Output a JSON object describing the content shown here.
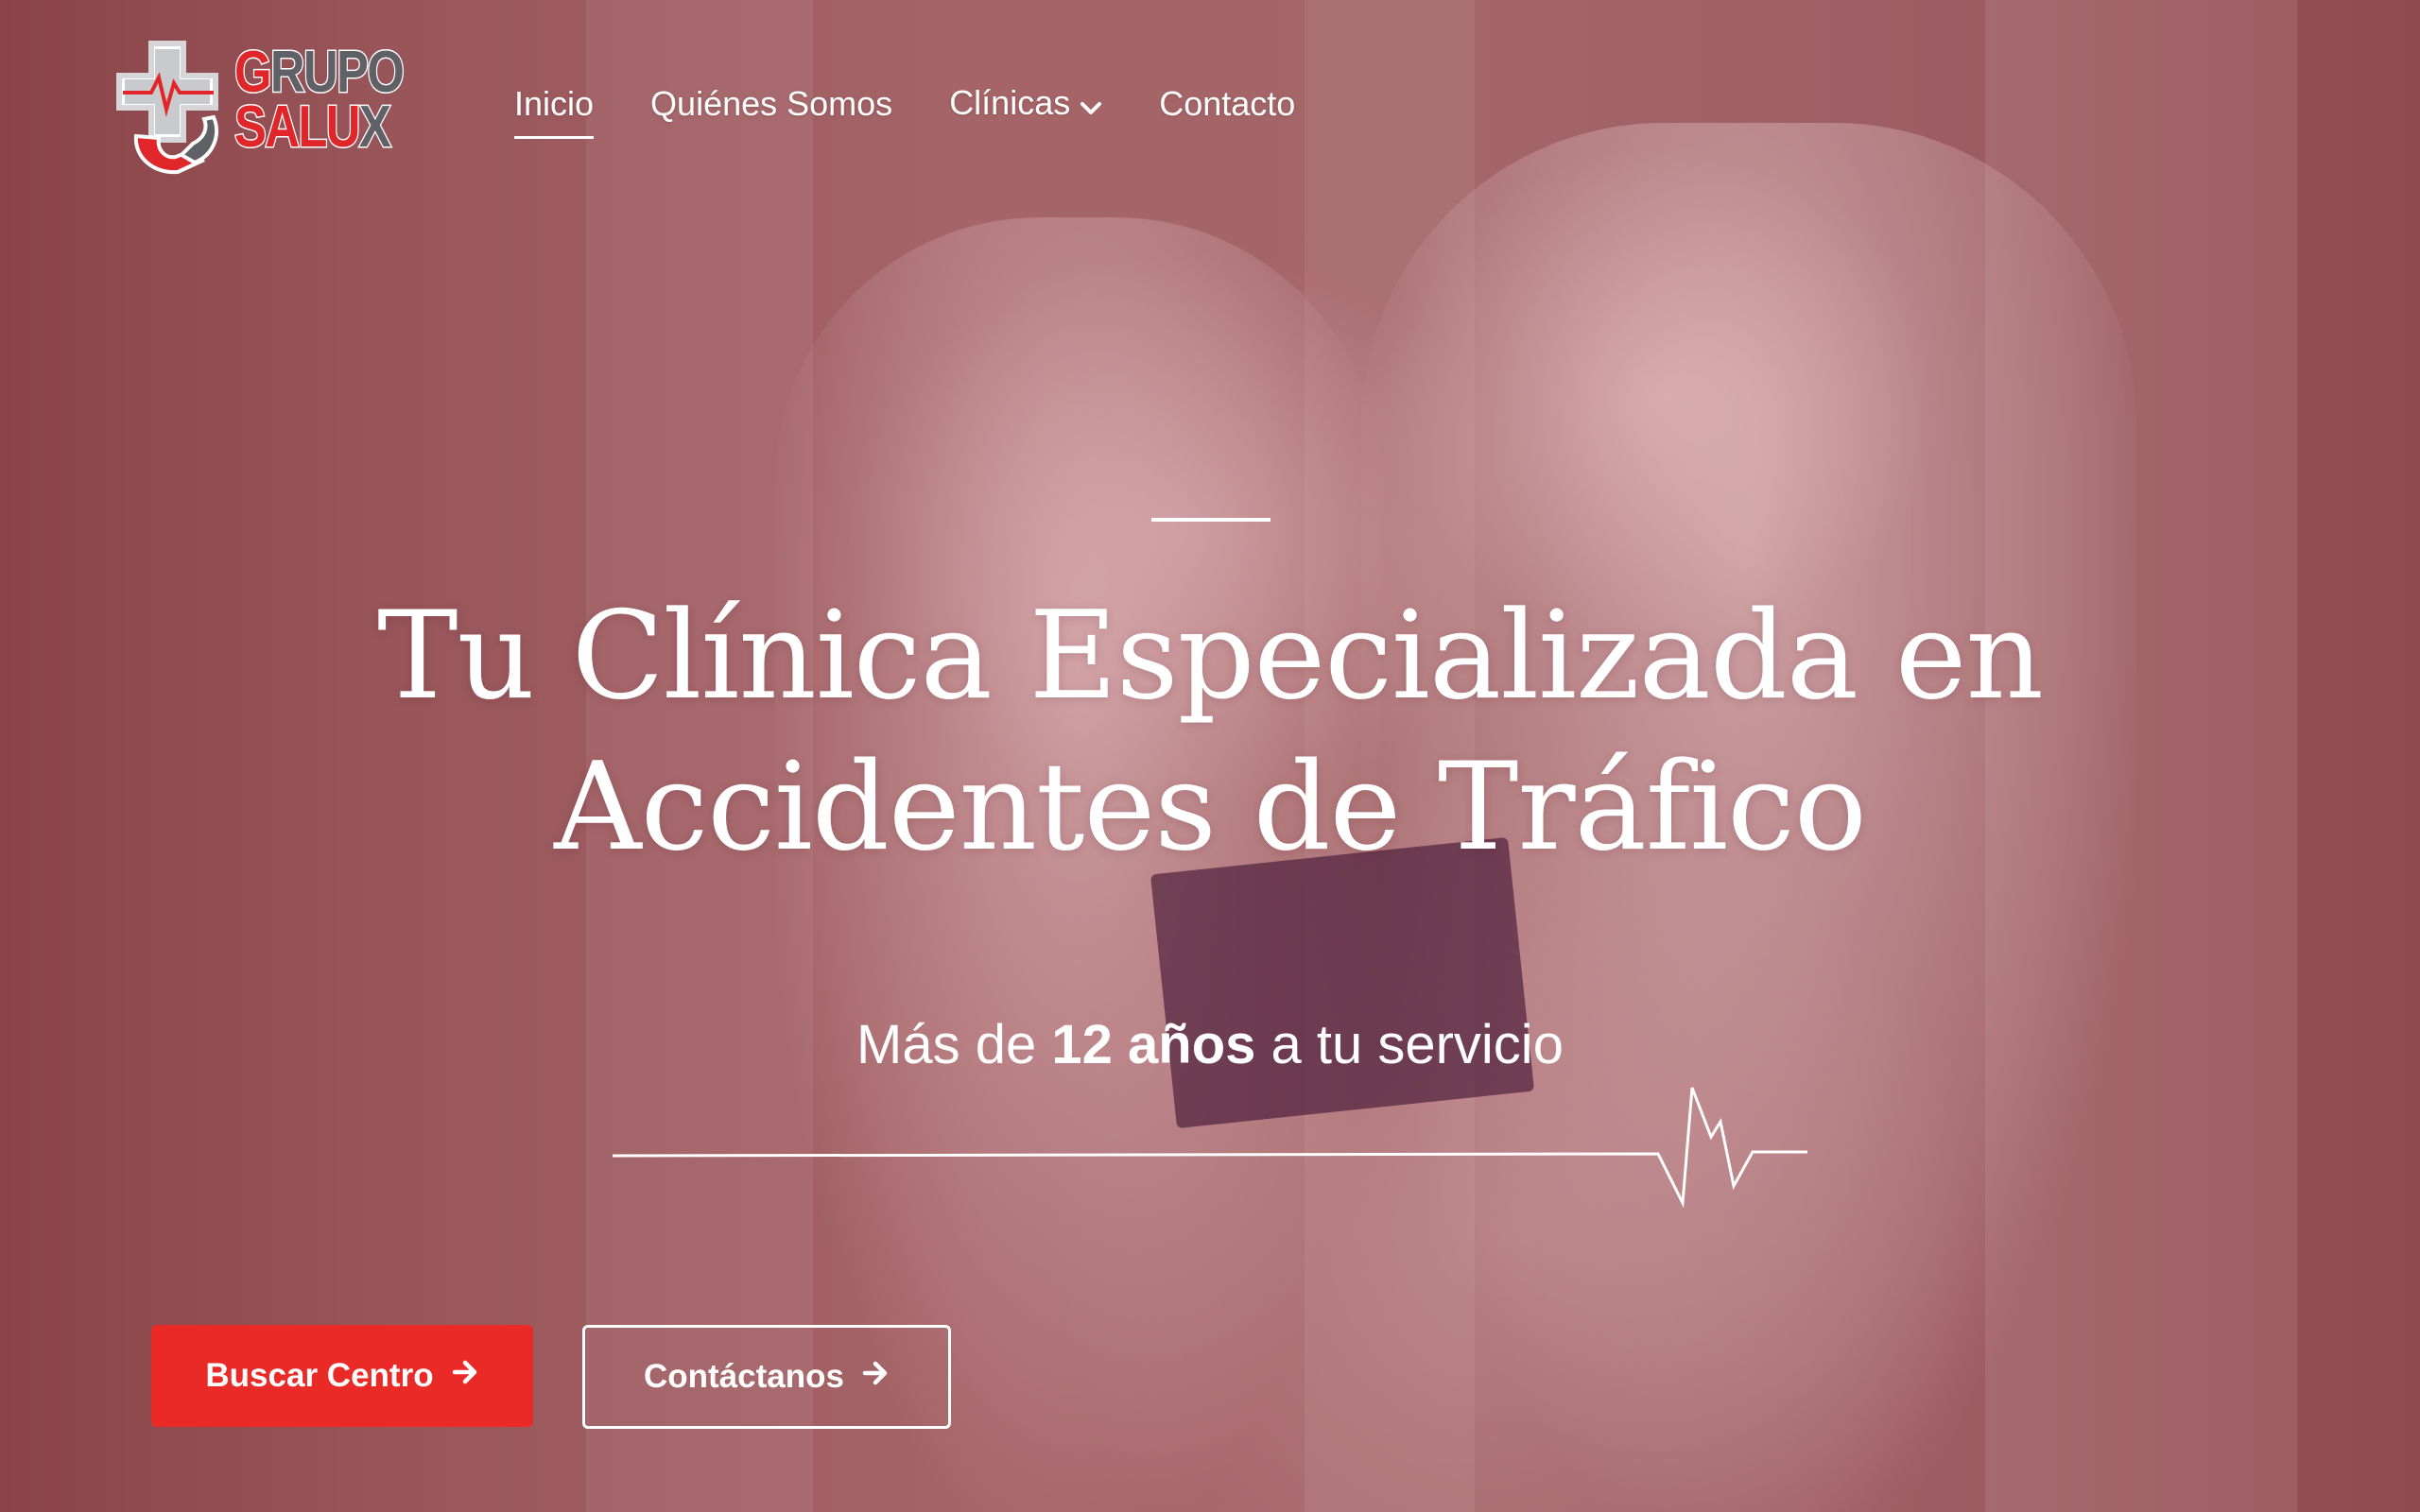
{
  "brand": {
    "line1_a": "G",
    "line1_b": "RUPO",
    "line2_a": "SALU",
    "line2_b": "X",
    "colors": {
      "red": "#e1262a",
      "gray": "#5f6166"
    }
  },
  "nav": {
    "items": [
      {
        "label": "Inicio",
        "active": true
      },
      {
        "label": "Quiénes Somos"
      },
      {
        "label": "Clínicas",
        "has_dropdown": true
      },
      {
        "label": "Contacto"
      }
    ]
  },
  "hero": {
    "title_line1": "Tu Clínica Especializada en",
    "title_line2": "Accidentes de Tráfico",
    "subtitle_pre": "Más de ",
    "subtitle_bold": "12 años",
    "subtitle_post": " a tu servicio"
  },
  "buttons": {
    "primary": {
      "label": "Buscar Centro",
      "icon": "arrow-right-icon",
      "color": "#e92a27"
    },
    "secondary": {
      "label": "Contáctanos",
      "icon": "arrow-right-icon"
    }
  }
}
